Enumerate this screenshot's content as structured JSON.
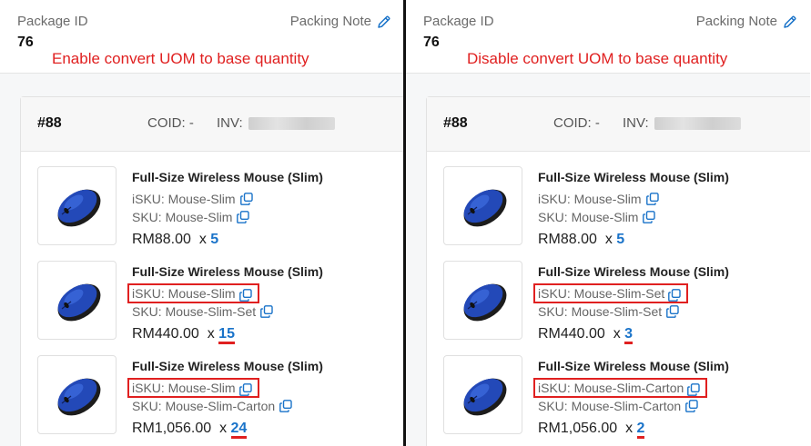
{
  "left": {
    "package_label": "Package ID",
    "package_id": "76",
    "packing_note": "Packing Note",
    "annotation": "Enable convert UOM to base quantity",
    "order_no": "#88",
    "coid": "COID: -",
    "inv": "INV:",
    "items": [
      {
        "name": "Full-Size Wireless Mouse (Slim)",
        "isku": "iSKU: Mouse-Slim",
        "sku": "SKU: Mouse-Slim",
        "price": "RM88.00",
        "x": "x",
        "qty": "5"
      },
      {
        "name": "Full-Size Wireless Mouse (Slim)",
        "isku": "iSKU: Mouse-Slim",
        "sku": "SKU: Mouse-Slim-Set",
        "price": "RM440.00",
        "x": "x",
        "qty": "15"
      },
      {
        "name": "Full-Size Wireless Mouse (Slim)",
        "isku": "iSKU: Mouse-Slim",
        "sku": "SKU: Mouse-Slim-Carton",
        "price": "RM1,056.00",
        "x": "x",
        "qty": "24"
      }
    ]
  },
  "right": {
    "package_label": "Package ID",
    "package_id": "76",
    "packing_note": "Packing Note",
    "annotation": "Disable convert UOM to base quantity",
    "order_no": "#88",
    "coid": "COID: -",
    "inv": "INV:",
    "items": [
      {
        "name": "Full-Size Wireless Mouse (Slim)",
        "isku": "iSKU: Mouse-Slim",
        "sku": "SKU: Mouse-Slim",
        "price": "RM88.00",
        "x": "x",
        "qty": "5"
      },
      {
        "name": "Full-Size Wireless Mouse (Slim)",
        "isku": "iSKU: Mouse-Slim-Set",
        "sku": "SKU: Mouse-Slim-Set",
        "price": "RM440.00",
        "x": "x",
        "qty": "3"
      },
      {
        "name": "Full-Size Wireless Mouse (Slim)",
        "isku": "iSKU: Mouse-Slim-Carton",
        "sku": "SKU: Mouse-Slim-Carton",
        "price": "RM1,056.00",
        "x": "x",
        "qty": "2"
      }
    ]
  },
  "colors": {
    "accent": "#1a73c9",
    "annotation": "#e02020"
  },
  "icons": {
    "edit": "pencil-icon",
    "copy": "copy-icon",
    "product": "wireless-mouse-image"
  }
}
